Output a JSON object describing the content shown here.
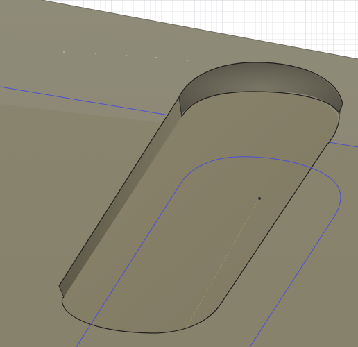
{
  "viewport": {
    "description_hidden": "",
    "grid_color": "#d9dde3",
    "background_color": "#ffffff",
    "top_face_color": "#8b8775",
    "wall_color": "#6f6b58",
    "floor_color": "#857f67",
    "sketch_line_color": "#4b4fd6",
    "edge_color": "#1f1f1f"
  }
}
